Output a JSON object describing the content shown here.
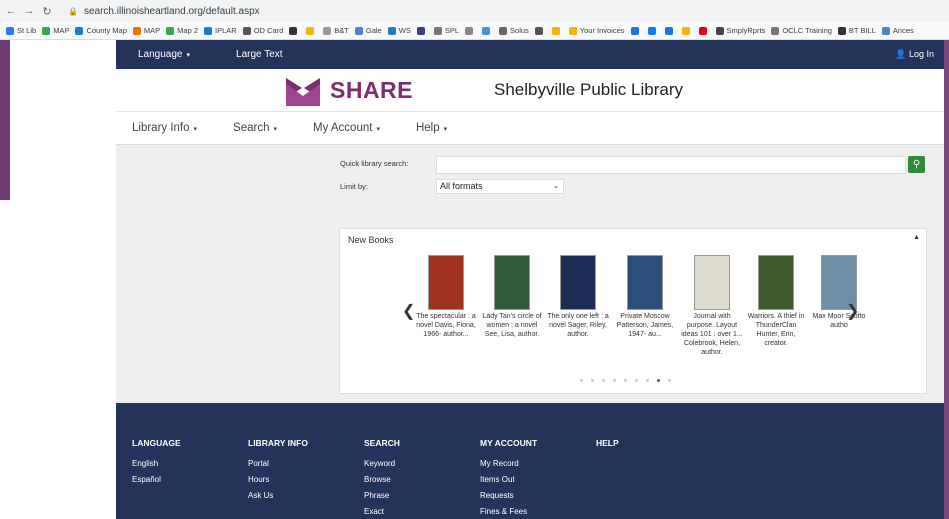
{
  "browser": {
    "url": "search.illinoisheartland.org/default.aspx",
    "bookmarks": [
      {
        "label": "St Lib",
        "color": "#2b7de9"
      },
      {
        "label": "MAP",
        "color": "#34a853"
      },
      {
        "label": "County Map",
        "color": "#1a73e8"
      },
      {
        "label": "MAP",
        "color": "#e37400"
      },
      {
        "label": "Map 2",
        "color": "#34a853"
      },
      {
        "label": "IPLAR",
        "color": "#1a73e8"
      },
      {
        "label": "OD Card",
        "color": "#555555"
      },
      {
        "label": "",
        "color": "#333333"
      },
      {
        "label": "",
        "color": "#f4b400"
      },
      {
        "label": "B&T",
        "color": "#999999"
      },
      {
        "label": "Gale",
        "color": "#4a86c5"
      },
      {
        "label": "WS",
        "color": "#2a7ab8"
      },
      {
        "label": "",
        "color": "#3a3a8a"
      },
      {
        "label": "SPL",
        "color": "#777777"
      },
      {
        "label": "",
        "color": "#888888"
      },
      {
        "label": "",
        "color": "#4a90d9"
      },
      {
        "label": "Solus",
        "color": "#666666"
      },
      {
        "label": "",
        "color": "#555555"
      },
      {
        "label": "",
        "color": "#f4b400"
      },
      {
        "label": "Your Invoices",
        "color": "#f4b400"
      },
      {
        "label": "",
        "color": "#1a73e8"
      },
      {
        "label": "",
        "color": "#1877f2"
      },
      {
        "label": "",
        "color": "#1a73e8"
      },
      {
        "label": "",
        "color": "#f4b400"
      },
      {
        "label": "",
        "color": "#e60023"
      },
      {
        "label": "SmplyRprts",
        "color": "#444444"
      },
      {
        "label": "OCLC Training",
        "color": "#777777"
      },
      {
        "label": "BT BILL",
        "color": "#333333"
      },
      {
        "label": "Ances",
        "color": "#4a86c5"
      }
    ]
  },
  "topbar": {
    "language": "Language",
    "large_text": "Large Text",
    "login": "Log In"
  },
  "header": {
    "logo_text": "SHARE",
    "library_name": "Shelbyville Public Library",
    "brand_color": "#7b2e6c"
  },
  "menu": {
    "items": [
      "Library Info",
      "Search",
      "My Account",
      "Help"
    ]
  },
  "search": {
    "quick_label": "Quick library search:",
    "quick_value": "",
    "limit_label": "Limit by:",
    "limit_value": "All formats"
  },
  "new_books": {
    "title": "New Books",
    "items": [
      {
        "caption": "The spectacular : a novel Davis, Fiona, 1966- author...",
        "cover": "#a03220"
      },
      {
        "caption": "Lady Tan's circle of women : a novel See, Lisa, author.",
        "cover": "#2f5a3a"
      },
      {
        "caption": "The only one left : a novel Sager, Riley, author.",
        "cover": "#1c2c55"
      },
      {
        "caption": "Private Moscow Patterson, James, 1947- au...",
        "cover": "#2c4e7a"
      },
      {
        "caption": "Journal with purpose. Layout ideas 101 : over 1... Colebrook, Helen, author.",
        "cover": "#dedbcf"
      },
      {
        "caption": "Warriors. A thief in ThunderClan Hunter, Erin, creator.",
        "cover": "#3f5a2a"
      },
      {
        "caption": "Max Moor Scotto autho",
        "cover": "#6f8fa6"
      }
    ],
    "active_dot": 7,
    "dot_count": 9
  },
  "footer": {
    "columns": [
      {
        "heading": "LANGUAGE",
        "links": [
          "English",
          "Español"
        ]
      },
      {
        "heading": "LIBRARY INFO",
        "links": [
          "Portal",
          "Hours",
          "Ask Us"
        ]
      },
      {
        "heading": "SEARCH",
        "links": [
          "Keyword",
          "Browse",
          "Phrase",
          "Exact"
        ]
      },
      {
        "heading": "MY ACCOUNT",
        "links": [
          "My Record",
          "Items Out",
          "Requests",
          "Fines & Fees"
        ]
      },
      {
        "heading": "HELP",
        "links": []
      }
    ]
  },
  "colors": {
    "navy": "#24335a",
    "search_button": "#2e8b3a"
  }
}
